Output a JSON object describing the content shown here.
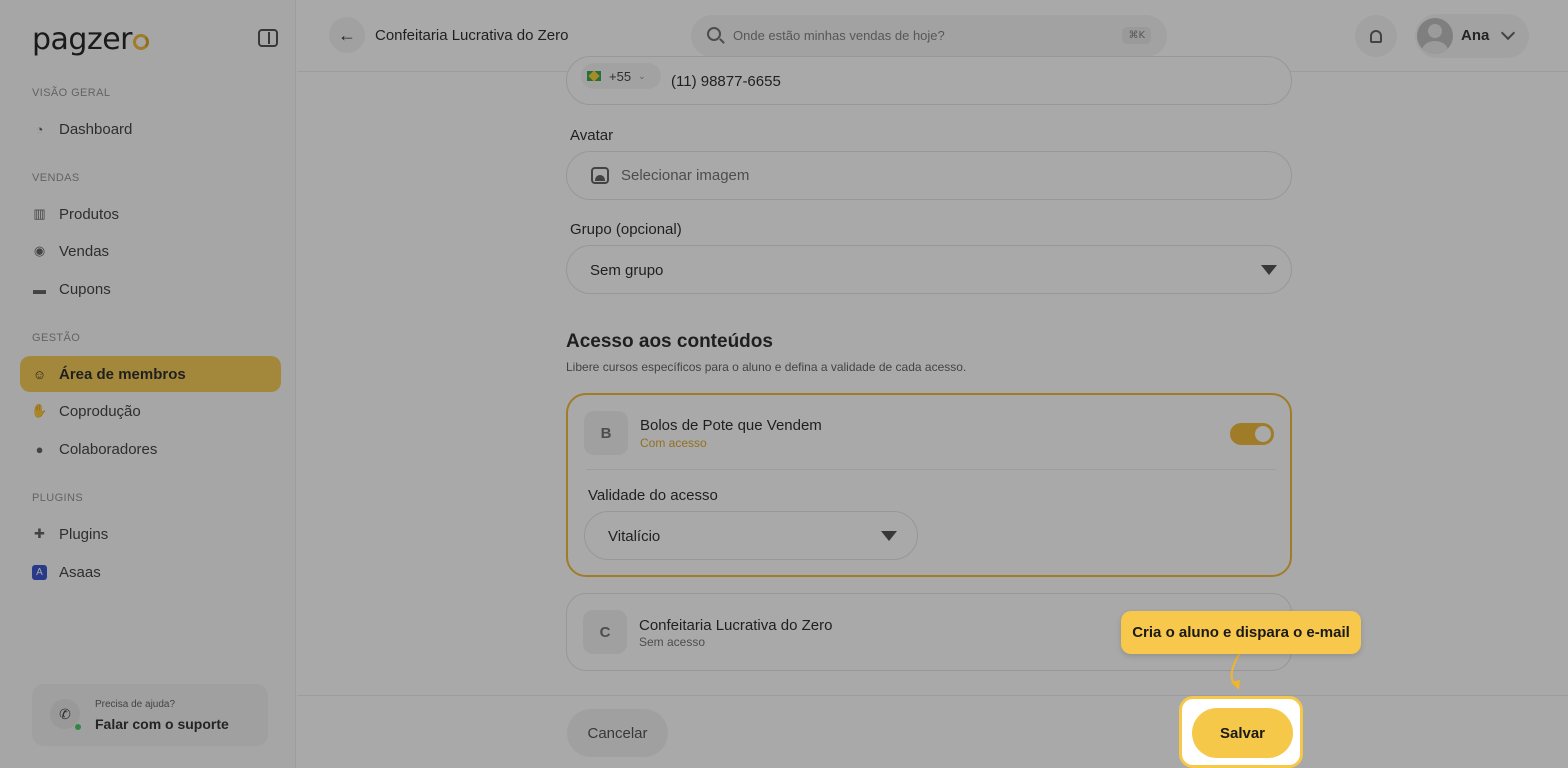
{
  "brand": {
    "logo_text": "pagzer",
    "accent_color": "#f5c84a"
  },
  "sidebar": {
    "sections": [
      {
        "title": "VISÃO GERAL",
        "items": [
          {
            "label": "Dashboard",
            "icon": "dashboard-icon"
          }
        ]
      },
      {
        "title": "VENDAS",
        "items": [
          {
            "label": "Produtos",
            "icon": "products-icon"
          },
          {
            "label": "Vendas",
            "icon": "sales-icon"
          },
          {
            "label": "Cupons",
            "icon": "coupon-icon"
          }
        ]
      },
      {
        "title": "GESTÃO",
        "items": [
          {
            "label": "Área de membros",
            "icon": "members-icon",
            "active": true
          },
          {
            "label": "Coprodução",
            "icon": "handshake-icon"
          },
          {
            "label": "Colaboradores",
            "icon": "user-icon"
          }
        ]
      },
      {
        "title": "PLUGINS",
        "items": [
          {
            "label": "Plugins",
            "icon": "puzzle-icon"
          },
          {
            "label": "Asaas",
            "icon": "asaas-icon"
          }
        ]
      }
    ],
    "support": {
      "line1": "Precisa de ajuda?",
      "line2": "Falar com o suporte"
    }
  },
  "topbar": {
    "title": "Confeitaria Lucrativa do Zero",
    "search_placeholder": "Onde estão minhas vendas de hoje?",
    "search_shortcut": "⌘K",
    "user_name": "Ana"
  },
  "form": {
    "phone": {
      "country_code": "+55",
      "value": "(11) 98877-6655"
    },
    "avatar": {
      "label": "Avatar",
      "placeholder": "Selecionar imagem"
    },
    "group": {
      "label": "Grupo (opcional)",
      "value": "Sem grupo"
    },
    "access": {
      "title": "Acesso aos conteúdos",
      "subtitle": "Libere cursos específicos para o aluno e defina a validade de cada acesso.",
      "courses": [
        {
          "initial": "B",
          "name": "Bolos de Pote que Vendem",
          "status": "Com acesso",
          "enabled": true,
          "validity_label": "Validade do acesso",
          "validity_value": "Vitalício"
        },
        {
          "initial": "C",
          "name": "Confeitaria Lucrativa do Zero",
          "status": "Sem acesso",
          "enabled": false
        }
      ]
    }
  },
  "footer": {
    "cancel_label": "Cancelar",
    "save_label": "Salvar"
  },
  "tour": {
    "tooltip_text": "Cria o aluno e dispara o e-mail"
  }
}
